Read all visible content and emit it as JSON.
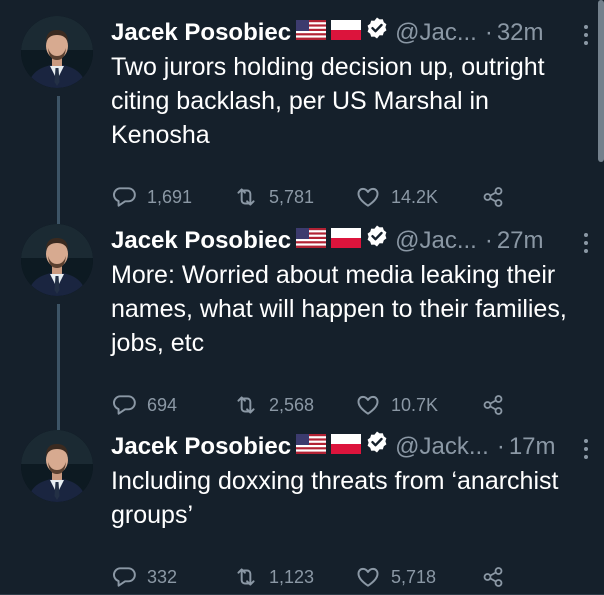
{
  "tweets": [
    {
      "name": "Jacek Posobiec",
      "handle": "@Jac...",
      "separator": "·",
      "time": "32m",
      "text": "Two jurors holding decision up, outright citing backlash, per US Marshal in Kenosha",
      "replies": "1,691",
      "retweets": "5,781",
      "likes": "14.2K"
    },
    {
      "name": "Jacek Posobiec",
      "handle": "@Jac...",
      "separator": "·",
      "time": "27m",
      "text": "More: Worried about media leaking their names, what will happen to their families, jobs, etc",
      "replies": "694",
      "retweets": "2,568",
      "likes": "10.7K"
    },
    {
      "name": "Jacek Posobiec",
      "handle": "@Jack...",
      "separator": "·",
      "time": "17m",
      "text": "Including doxxing threats from ‘anarchist groups’",
      "replies": "332",
      "retweets": "1,123",
      "likes": "5,718"
    }
  ],
  "icons": {
    "more": "more-vertical-icon",
    "reply": "reply-icon",
    "retweet": "retweet-icon",
    "like": "heart-icon",
    "share": "share-icon",
    "verified": "verified-badge-icon",
    "flag_us": "us-flag-icon",
    "flag_pl": "poland-flag-icon"
  },
  "colors": {
    "background": "#15202b",
    "text": "#ffffff",
    "muted": "#8b98a5",
    "thread_line": "#3d5466"
  }
}
